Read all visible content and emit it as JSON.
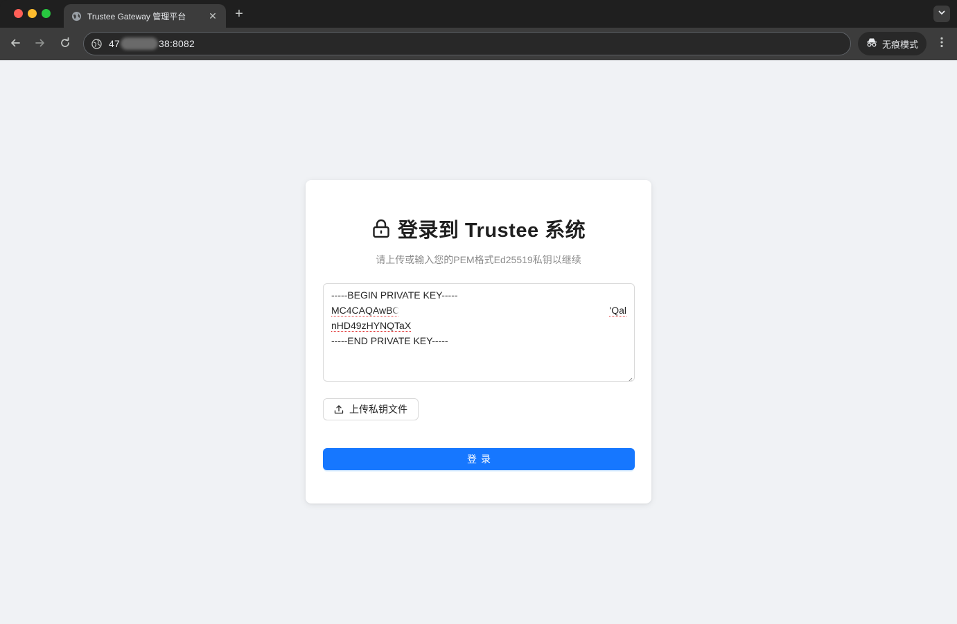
{
  "browser": {
    "tab": {
      "title": "Trustee Gateway 管理平台",
      "close": "✕"
    },
    "new_tab": "+",
    "url": {
      "prefix": "47",
      "suffix": "38:8082"
    },
    "incognito_label": "无痕模式"
  },
  "login": {
    "title": "登录到 Trustee 系统",
    "subtitle": "请上传或输入您的PEM格式Ed25519私钥以继续",
    "key": {
      "line1": "-----BEGIN PRIVATE KEY-----",
      "line2_start": "MC4CAQAwBC",
      "line2_end": "'Qal",
      "line3": "nHD49zHYNQTaX",
      "line4": "-----END PRIVATE KEY-----"
    },
    "upload_label": "上传私钥文件",
    "login_label": "登录"
  },
  "colors": {
    "page_bg": "#f0f2f5",
    "primary": "#1677ff",
    "chrome_dark": "#1f1f1f",
    "toolbar": "#3c3c3c"
  }
}
